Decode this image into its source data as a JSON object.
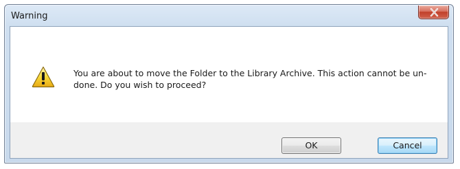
{
  "dialog": {
    "title": "Warning",
    "message": "You are about to move the Folder to the Library Archive. This action cannot be un-done. Do you wish to proceed?",
    "icon": "warning-icon",
    "close_icon": "close-icon"
  },
  "buttons": {
    "ok_label": "OK",
    "cancel_label": "Cancel"
  },
  "colors": {
    "close_button": "#c1402b",
    "focused_button_border": "#3c7fb1",
    "warning_yellow": "#f7d238"
  }
}
